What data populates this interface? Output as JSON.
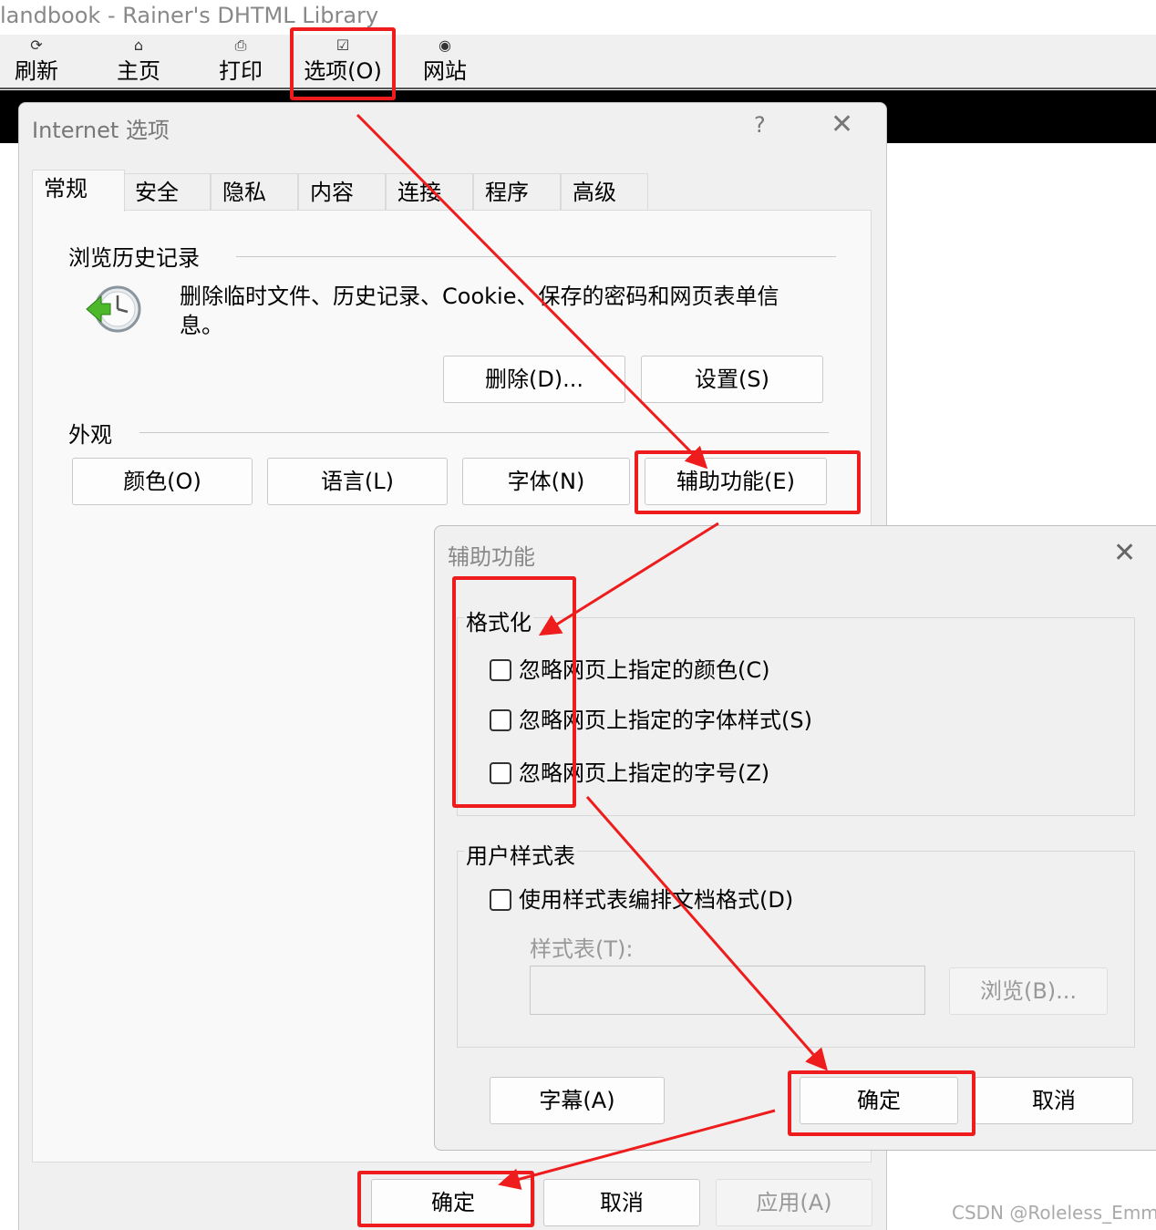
{
  "window": {
    "title": "landbook - Rainer's DHTML Library"
  },
  "toolbar": {
    "buttons": [
      {
        "icon": "refresh-icon",
        "glyph": "⟳",
        "label": "刷新"
      },
      {
        "icon": "home-icon",
        "glyph": "⌂",
        "label": "主页"
      },
      {
        "icon": "print-icon",
        "glyph": "⎙",
        "label": "打印"
      },
      {
        "icon": "options-icon",
        "glyph": "☑",
        "label": "选项(O)"
      },
      {
        "icon": "web-icon",
        "glyph": "◉",
        "label": "网站"
      }
    ]
  },
  "internet_options": {
    "title": "Internet 选项",
    "help_glyph": "?",
    "close_glyph": "✕",
    "tabs": [
      "常规",
      "安全",
      "隐私",
      "内容",
      "连接",
      "程序",
      "高级"
    ],
    "active_tab": "常规",
    "history": {
      "title": "浏览历史记录",
      "description": "删除临时文件、历史记录、Cookie、保存的密码和网页表单信息。",
      "delete_button": "删除(D)...",
      "settings_button": "设置(S)"
    },
    "appearance": {
      "title": "外观",
      "colors_button": "颜色(O)",
      "languages_button": "语言(L)",
      "fonts_button": "字体(N)",
      "accessibility_button": "辅助功能(E)"
    },
    "footer": {
      "ok": "确定",
      "cancel": "取消",
      "apply": "应用(A)"
    }
  },
  "accessibility": {
    "title": "辅助功能",
    "close_glyph": "✕",
    "formatting": {
      "title": "格式化",
      "options": [
        {
          "label": "忽略网页上指定的颜色(C)",
          "checked": false
        },
        {
          "label": "忽略网页上指定的字体样式(S)",
          "checked": false
        },
        {
          "label": "忽略网页上指定的字号(Z)",
          "checked": false
        }
      ]
    },
    "user_stylesheet": {
      "title": "用户样式表",
      "use_stylesheet": {
        "label": "使用样式表编排文档格式(D)",
        "checked": false
      },
      "stylesheet_label": "样式表(T):",
      "stylesheet_value": "",
      "browse_button": "浏览(B)..."
    },
    "captions_button": "字幕(A)",
    "ok": "确定",
    "cancel": "取消"
  },
  "watermark": "CSDN @Roleless_Emma",
  "annotation_color": "#ee1c1c"
}
